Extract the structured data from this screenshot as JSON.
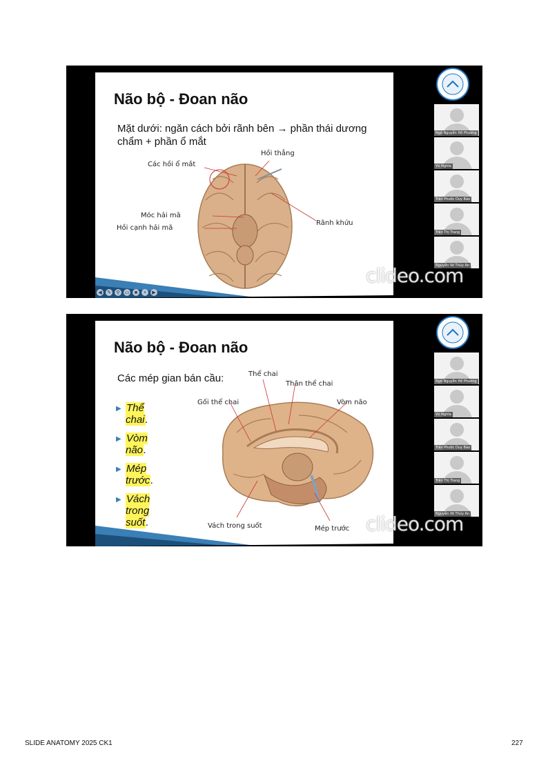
{
  "slide1": {
    "title": "Não bộ - Đoan não",
    "subtitle": "Mặt dưới: ngăn cách bởi rãnh bên → phần thái dương chẩm + phần ổ mắt",
    "labels": {
      "hoi_thang": "Hồi thẳng",
      "cac_hoi_o_mat": "Các hồi ổ mắt",
      "moc_hai_ma": "Móc hải mã",
      "hoi_canh_hai_ma": "Hồi cạnh hải mã",
      "ranh_khuu": "Rãnh khứu"
    }
  },
  "slide2": {
    "title": "Não bộ - Đoan não",
    "subtitle": "Các mép gian bán cầu:",
    "bullets": [
      "Thể chai",
      "Vòm não",
      "Mép trước",
      "Vách trong suốt"
    ],
    "labels": {
      "the_chai": "Thể chai",
      "than_the_chai": "Thân thể chai",
      "goi_the_chai": "Gối thể chai",
      "vom_nao": "Vòm não",
      "vach_trong_suot": "Vách trong suốt",
      "mep_truoc": "Mép trước"
    }
  },
  "participants": [
    "Ngô Nguyễn Hồ Phương",
    "Vũ Nghĩa",
    "Trần Phước Duy Bảo",
    "Trần Thị Trang",
    "Nguyễn Võ Thủy An"
  ],
  "watermark": "clideo.com",
  "footer": {
    "left": "SLIDE ANATOMY 2025 CK1",
    "page": "227"
  },
  "colors": {
    "accent": "#3b7fb5",
    "highlight": "#fff45a",
    "brain": "#dcb48a"
  }
}
